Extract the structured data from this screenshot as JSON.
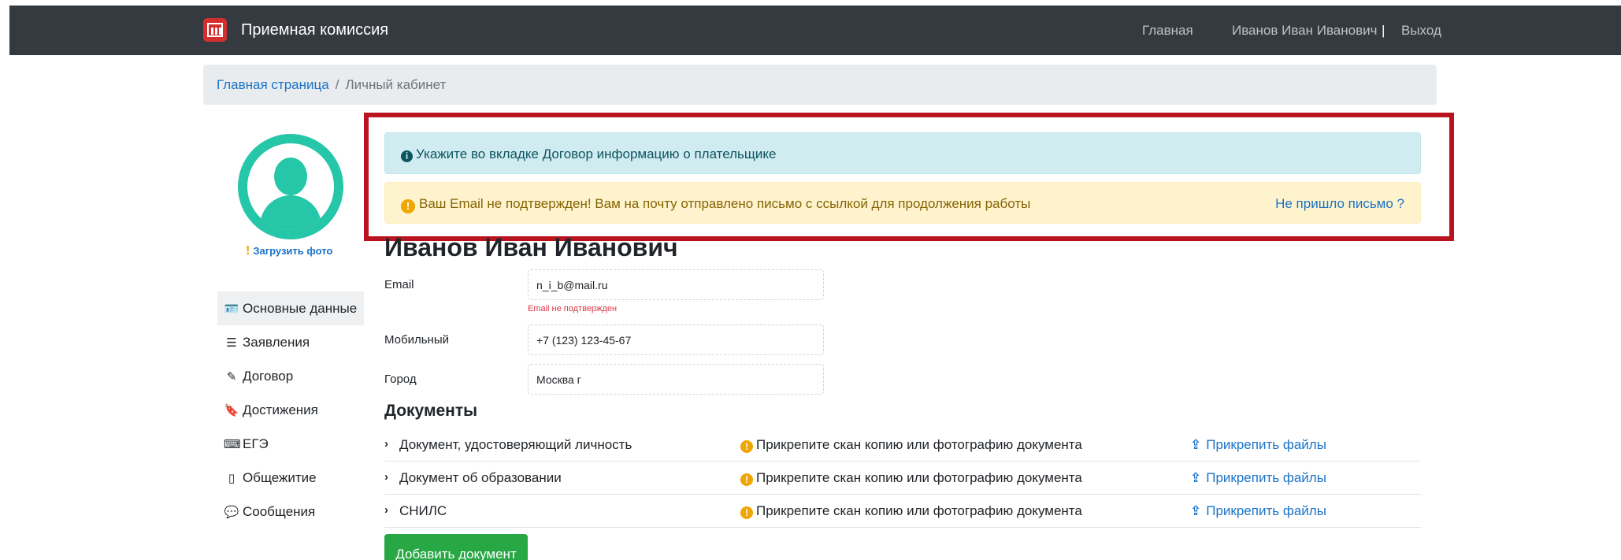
{
  "header": {
    "brand_title": "Приемная комиссия",
    "logo_icon": "building-icon",
    "nav": {
      "home": "Главная",
      "user": "Иванов Иван Иванович",
      "separator": "|",
      "logout": "Выход"
    }
  },
  "breadcrumb": {
    "home": "Главная страница",
    "separator": "/",
    "current": "Личный кабинет"
  },
  "profile": {
    "upload_photo": "Загрузить фото",
    "full_name": "Иванов Иван Иванович"
  },
  "sidebar": {
    "items": [
      {
        "label": "Основные данные",
        "icon": "id-card-icon",
        "glyph": "🪪",
        "active": true
      },
      {
        "label": "Заявления",
        "icon": "list-icon",
        "glyph": "☰"
      },
      {
        "label": "Договор",
        "icon": "edit-icon",
        "glyph": "✎"
      },
      {
        "label": "Достижения",
        "icon": "bookmark-icon",
        "glyph": "🔖"
      },
      {
        "label": "ЕГЭ",
        "icon": "keyboard-icon",
        "glyph": "⌨"
      },
      {
        "label": "Общежитие",
        "icon": "mobile-icon",
        "glyph": "▯"
      },
      {
        "label": "Сообщения",
        "icon": "comment-icon",
        "glyph": "💬"
      }
    ]
  },
  "alerts": {
    "info": "Укажите во вкладке Договор информацию о плательщике",
    "warning": "Ваш Email не подтвержден! Вам на почту отправлено письмо с ссылкой для продолжения работы",
    "resend_link": "Не пришло письмо ?"
  },
  "fields": {
    "email_label": "Email",
    "email_value": "n_i_b@mail.ru",
    "email_error": "Email не подтвержден",
    "mobile_label": "Мобильный",
    "mobile_value": "+7 (123) 123-45-67",
    "city_label": "Город",
    "city_value": "Москва г"
  },
  "documents": {
    "title": "Документы",
    "rows": [
      {
        "name": "Документ, удостоверяющий личность",
        "hint": "Прикрепите скан копию или фотографию документа",
        "action": "Прикрепить файлы"
      },
      {
        "name": "Документ об образовании",
        "hint": "Прикрепите скан копию или фотографию документа",
        "action": "Прикрепить файлы"
      },
      {
        "name": "СНИЛС",
        "hint": "Прикрепите скан копию или фотографию документа",
        "action": "Прикрепить файлы"
      }
    ],
    "add_button": "Добавить документ"
  },
  "colors": {
    "navbar": "#343a40",
    "accent_link": "#1a73c8",
    "avatar": "#26c6a8",
    "highlight_frame": "#b8131f",
    "success_button": "#28a745"
  }
}
